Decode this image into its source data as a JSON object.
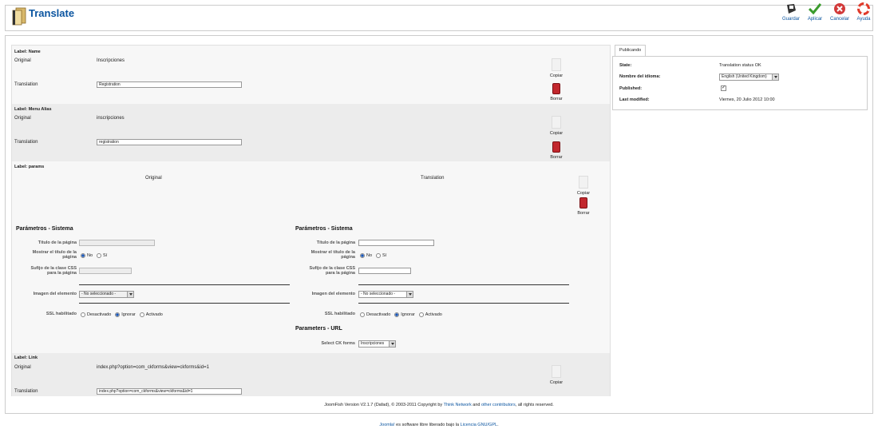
{
  "header": {
    "title": "Translate",
    "buttons": {
      "save": "Guardar",
      "apply": "Aplicar",
      "cancel": "Cancelar",
      "help": "Ayuda"
    }
  },
  "fields": {
    "name": {
      "label": "Label: Name",
      "original_label": "Original",
      "original": "Inscripciones",
      "translation_label": "Translation",
      "translation": "Registration"
    },
    "alias": {
      "label": "Label: Menu Alias",
      "original_label": "Original",
      "original": "inscripciones",
      "translation_label": "Translation",
      "translation": "registration"
    },
    "params": {
      "label": "Label: params",
      "col_original": "Original",
      "col_translation": "Translation"
    },
    "link": {
      "label": "Label: Link",
      "original_label": "Original",
      "original": "index.php?option=com_ckforms&view=ckforms&id=1",
      "translation_label": "Translation",
      "translation": "index.php?option=com_ckforms&view=ckforms&id=1"
    }
  },
  "actions": {
    "copy": "Copiar",
    "delete": "Borrar"
  },
  "params": {
    "system_title": "Parámetros - Sistema",
    "page_title_label": "Título de la página",
    "show_title_label_1": "Mostrar el título de la",
    "show_title_label_2": "página",
    "css_label_1": "Sufijo de la clase CSS",
    "css_label_2": "para la página",
    "image_label": "Imagen del elemento",
    "image_value": "- No seleccionado -",
    "ssl_label": "SSL habilitado",
    "no": "No",
    "yes": "Sí",
    "ssl_off": "Desactivado",
    "ssl_ignore": "Ignorar",
    "ssl_on": "Activado",
    "url_title": "Parameters - URL",
    "ck_label": "Select CK forms",
    "ck_value": "Inscripciones"
  },
  "publish": {
    "tab": "Publicando",
    "state_label": "State:",
    "state_value": "Translation status OK",
    "lang_label": "Nombre del idioma:",
    "lang_value": "English (United Kingdom)",
    "published_label": "Published:",
    "modified_label": "Last modified:",
    "modified_value": "Viernes, 20 Julio 2012 10:00"
  },
  "footer": {
    "version_pre": "JoomFish Version V2.1.7 (Dafad), © 2003-2011 Copyright by ",
    "link1": "Think Network",
    "mid": " and ",
    "link2": "other contributors",
    "post": ", all rights reserved.",
    "joomla_link": "Joomla!",
    "joomla_text": " es software libre liberado bajo la ",
    "license_link": "Licencia GNU/GPL",
    "joomla_end": "."
  },
  "colors": {
    "accent": "#0b55a0",
    "delete": "#c2272d",
    "apply": "#3a9b2c"
  }
}
